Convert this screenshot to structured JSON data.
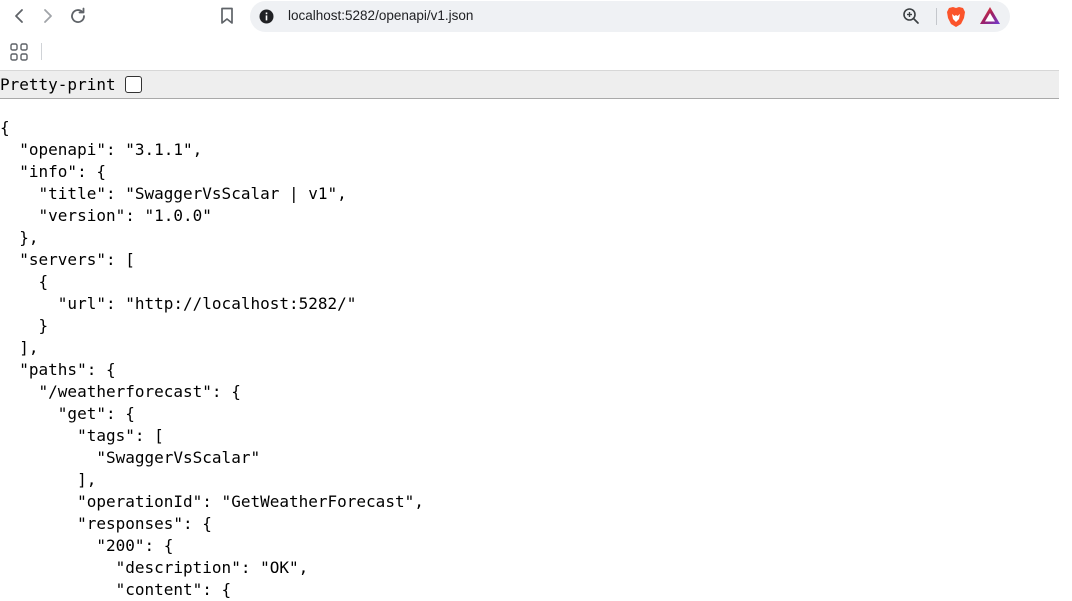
{
  "browser": {
    "url": "localhost:5282/openapi/v1.json",
    "icons": {
      "back": "arrow-left-icon",
      "forward": "arrow-right-icon",
      "reload": "reload-icon",
      "bookmark": "bookmark-icon",
      "site_info": "info-circle-icon",
      "zoom": "zoom-in-icon",
      "brave_shields": "brave-lion-icon",
      "rewards": "brave-rewards-triangle-icon",
      "apps": "apps-grid-icon"
    }
  },
  "pretty_print": {
    "label": "Pretty-print",
    "checked": false
  },
  "json_lines": [
    "{",
    "  \"openapi\": \"3.1.1\",",
    "  \"info\": {",
    "    \"title\": \"SwaggerVsScalar | v1\",",
    "    \"version\": \"1.0.0\"",
    "  },",
    "  \"servers\": [",
    "    {",
    "      \"url\": \"http://localhost:5282/\"",
    "    }",
    "  ],",
    "  \"paths\": {",
    "    \"/weatherforecast\": {",
    "      \"get\": {",
    "        \"tags\": [",
    "          \"SwaggerVsScalar\"",
    "        ],",
    "        \"operationId\": \"GetWeatherForecast\",",
    "        \"responses\": {",
    "          \"200\": {",
    "            \"description\": \"OK\",",
    "            \"content\": {"
  ],
  "colors": {
    "omnibox": "#eff1f4",
    "pretty_print_bar": "#eeeeee",
    "brave_orange": "#fb542b",
    "rewards_purple": "#6e3dd4"
  }
}
